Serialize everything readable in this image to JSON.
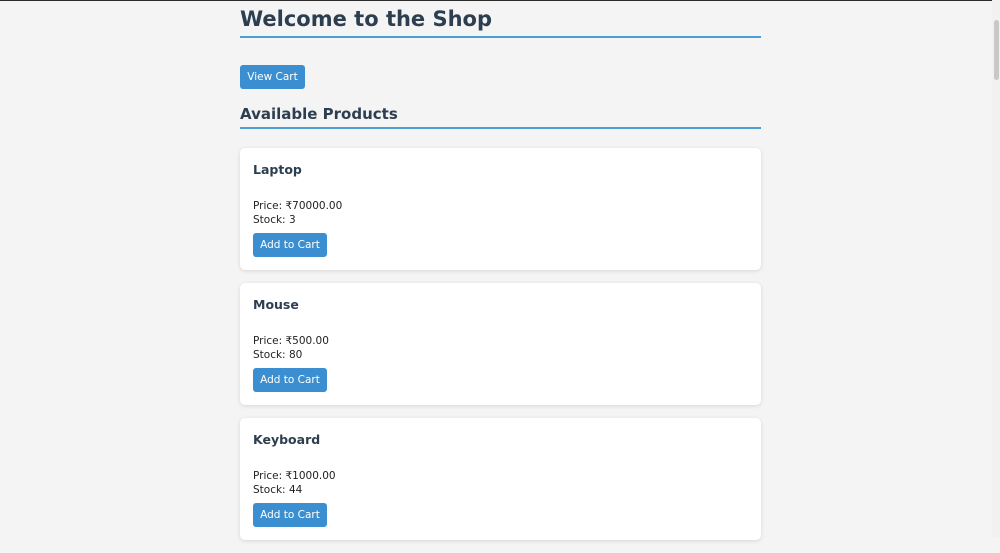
{
  "header": {
    "title": "Welcome to the Shop"
  },
  "toolbar": {
    "view_cart_label": "View Cart"
  },
  "products_section": {
    "title": "Available Products",
    "price_prefix": "Price: ",
    "stock_prefix": "Stock: ",
    "add_label": "Add to Cart",
    "items": [
      {
        "name": "Laptop",
        "price": "₹70000.00",
        "stock": "3"
      },
      {
        "name": "Mouse",
        "price": "₹500.00",
        "stock": "80"
      },
      {
        "name": "Keyboard",
        "price": "₹1000.00",
        "stock": "44"
      }
    ]
  },
  "colors": {
    "accent": "#3b8fd0",
    "heading": "#2c3e50",
    "background": "#f4f4f4"
  }
}
